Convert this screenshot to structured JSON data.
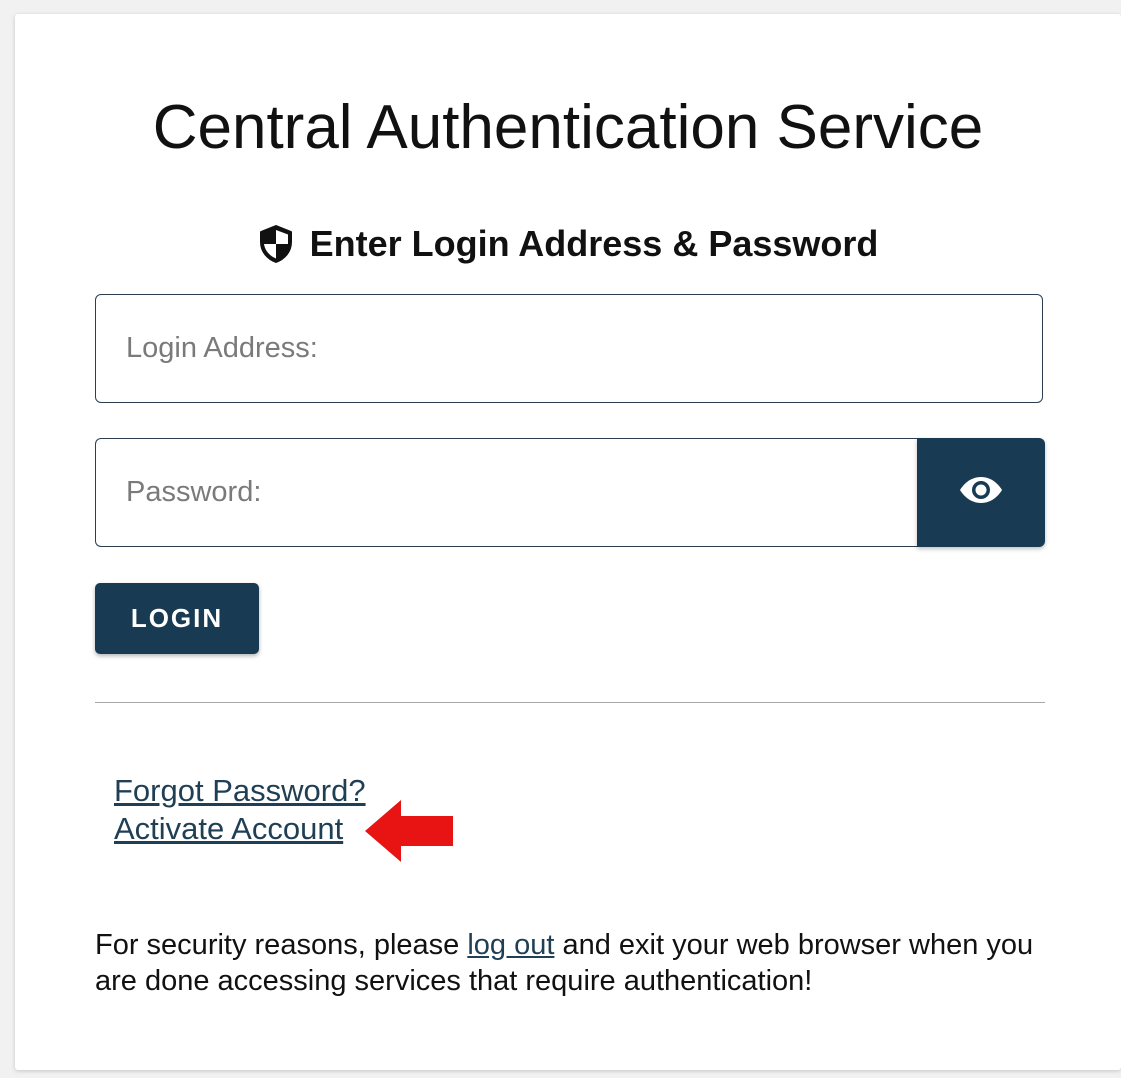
{
  "title": "Central Authentication Service",
  "subtitle": {
    "icon": "shield-icon",
    "text": "Enter Login Address & Password"
  },
  "form": {
    "login_placeholder": "Login Address:",
    "login_value": "",
    "password_placeholder": "Password:",
    "password_value": "",
    "show_password_icon": "eye-icon",
    "login_button_label": "LOGIN"
  },
  "links": {
    "forgot_password": "Forgot Password?",
    "activate_account": "Activate Account"
  },
  "annotation": {
    "arrow_color": "#e81414"
  },
  "notice": {
    "prefix": "For security reasons, please ",
    "link": "log out",
    "suffix": " and exit your web browser when you are done accessing services that require authentication!"
  },
  "colors": {
    "primary": "#183a52",
    "link": "#1f3f55"
  }
}
